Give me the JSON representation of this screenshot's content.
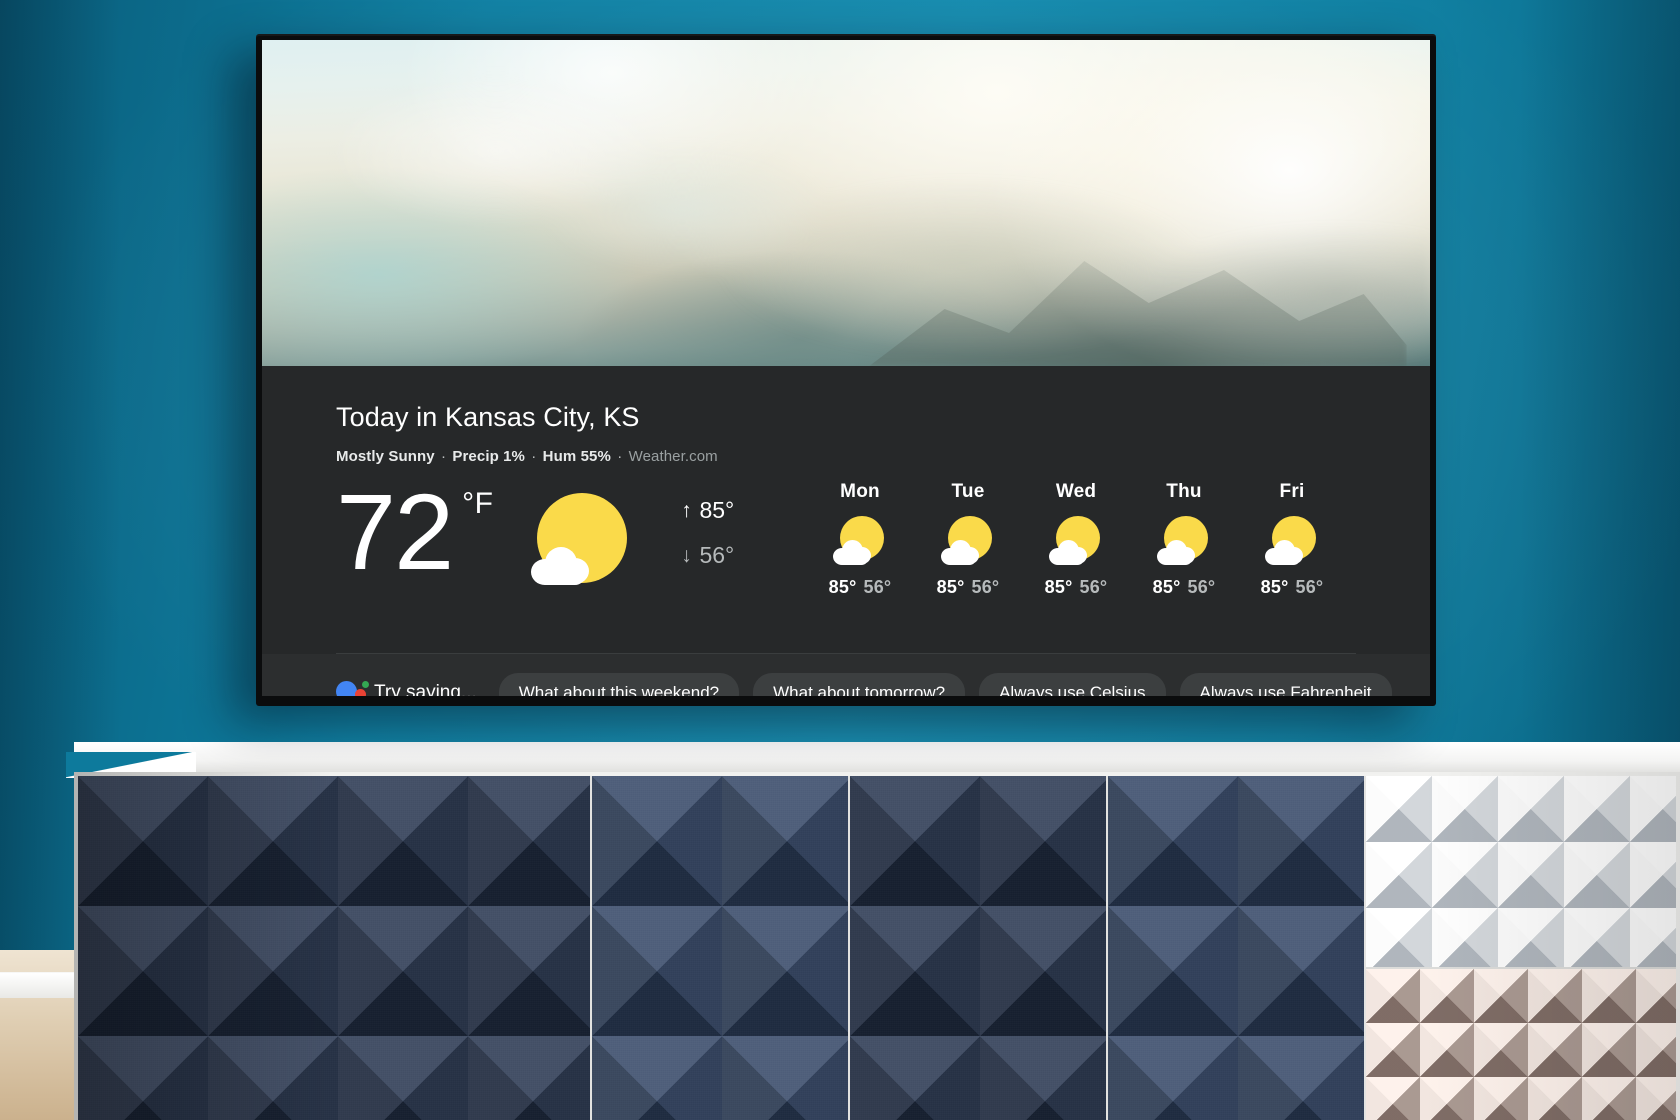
{
  "scene": {
    "wall_color": "#0d7a9c",
    "tv_bezel_color": "#0b0c0d"
  },
  "card": {
    "title": "Today in Kansas City, KS",
    "conditions": "Mostly Sunny",
    "sep": "·",
    "precip": "Precip 1%",
    "humidity": "Hum 55%",
    "source": "Weather.com",
    "current_temp": "72",
    "current_unit": "°F",
    "current_icon": "sun-behind-cloud-icon",
    "high_arrow": "↑",
    "high_temp": "85°",
    "low_arrow": "↓",
    "low_temp": "56°",
    "background_color": "#262829"
  },
  "forecast": [
    {
      "day": "Mon",
      "icon": "sun-behind-cloud-icon",
      "high": "85°",
      "low": "56°"
    },
    {
      "day": "Tue",
      "icon": "sun-behind-cloud-icon",
      "high": "85°",
      "low": "56°"
    },
    {
      "day": "Wed",
      "icon": "sun-behind-cloud-icon",
      "high": "85°",
      "low": "56°"
    },
    {
      "day": "Thu",
      "icon": "sun-behind-cloud-icon",
      "high": "85°",
      "low": "56°"
    },
    {
      "day": "Fri",
      "icon": "sun-behind-cloud-icon",
      "high": "85°",
      "low": "56°"
    }
  ],
  "suggestions": {
    "assistant_icon": "google-assistant-dots-icon",
    "prompt": "Try saying...",
    "chips": [
      "What about this weekend?",
      "What about tomorrow?",
      "Always use Celsius",
      "Always use Fahrenheit"
    ],
    "background_color": "#2c2e2f",
    "chip_color": "#3c3f40"
  },
  "assistant_colors": {
    "blue": "#4285f4",
    "red": "#ea4335",
    "yellow": "#fbbc05",
    "green": "#34a853"
  }
}
